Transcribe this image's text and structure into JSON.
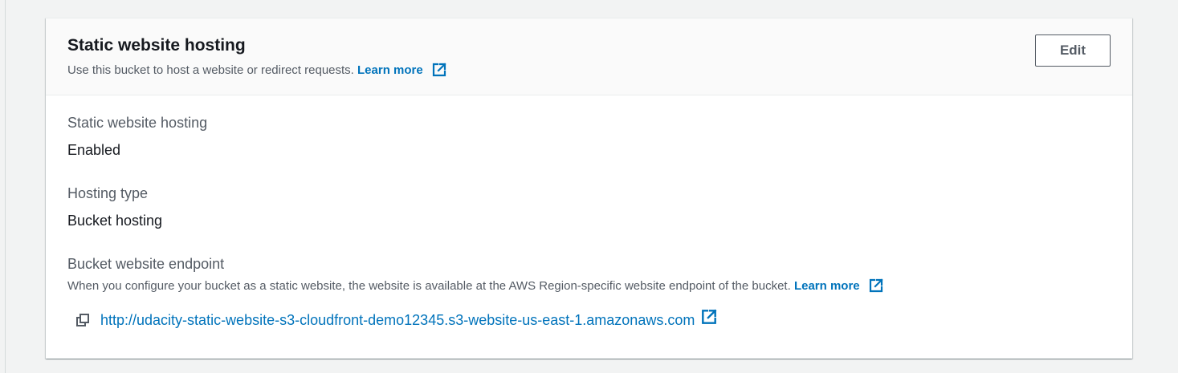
{
  "panel": {
    "title": "Static website hosting",
    "description": "Use this bucket to host a website or redirect requests.",
    "learn_more": "Learn more",
    "edit_label": "Edit"
  },
  "fields": {
    "hosting_status": {
      "label": "Static website hosting",
      "value": "Enabled"
    },
    "hosting_type": {
      "label": "Hosting type",
      "value": "Bucket hosting"
    },
    "endpoint": {
      "label": "Bucket website endpoint",
      "description": "When you configure your bucket as a static website, the website is available at the AWS Region-specific website endpoint of the bucket.",
      "learn_more": "Learn more",
      "url": "http://udacity-static-website-s3-cloudfront-demo12345.s3-website-us-east-1.amazonaws.com"
    }
  },
  "icons": {
    "external_link": "external-link-icon",
    "copy": "copy-icon"
  },
  "colors": {
    "link": "#0073bb",
    "text": "#16191f",
    "secondary_text": "#545b64",
    "header_bg": "#fafafa",
    "page_bg": "#f2f3f3"
  }
}
